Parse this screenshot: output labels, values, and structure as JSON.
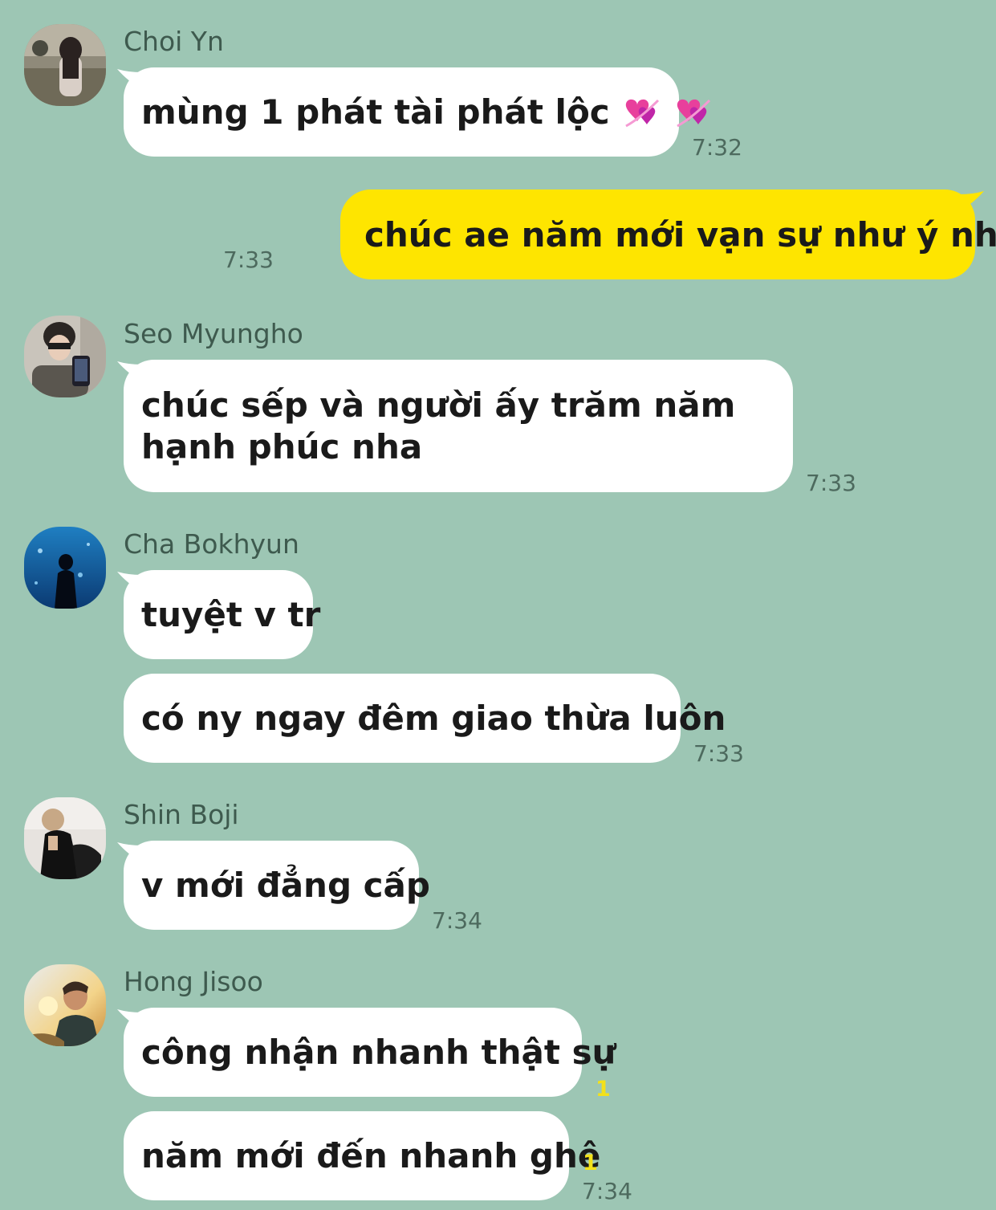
{
  "colors": {
    "background": "#9dc6b4",
    "bubble_other": "#ffffff",
    "bubble_mine": "#fee500",
    "unread_count": "#f3e11a"
  },
  "messages": [
    {
      "sender": "Choi Yn",
      "avatar": "choi-yn-avatar",
      "text": "mùng 1 phát tài phát lộc",
      "emoji": "two-hearts-icon",
      "time": "7:32"
    },
    {
      "sender": "me",
      "text": "chúc ae năm mới vạn sự như ý nha",
      "time": "7:33"
    },
    {
      "sender": "Seo Myungho",
      "avatar": "seo-myungho-avatar",
      "text": "chúc sếp và người ấy trăm năm hạnh phúc nha",
      "time": "7:33"
    },
    {
      "sender": "Cha Bokhyun",
      "avatar": "cha-bokhyun-avatar",
      "texts": [
        "tuyệt v tr",
        "có ny ngay đêm giao thừa luôn"
      ],
      "time": "7:33"
    },
    {
      "sender": "Shin Boji",
      "avatar": "shin-boji-avatar",
      "text": "v mới đẳng cấp",
      "time": "7:34"
    },
    {
      "sender": "Hong Jisoo",
      "avatar": "hong-jisoo-avatar",
      "texts": [
        "công nhận nhanh thật sự",
        "năm mới đến nhanh ghê"
      ],
      "unread": [
        "1",
        "1"
      ],
      "time": "7:34"
    }
  ]
}
